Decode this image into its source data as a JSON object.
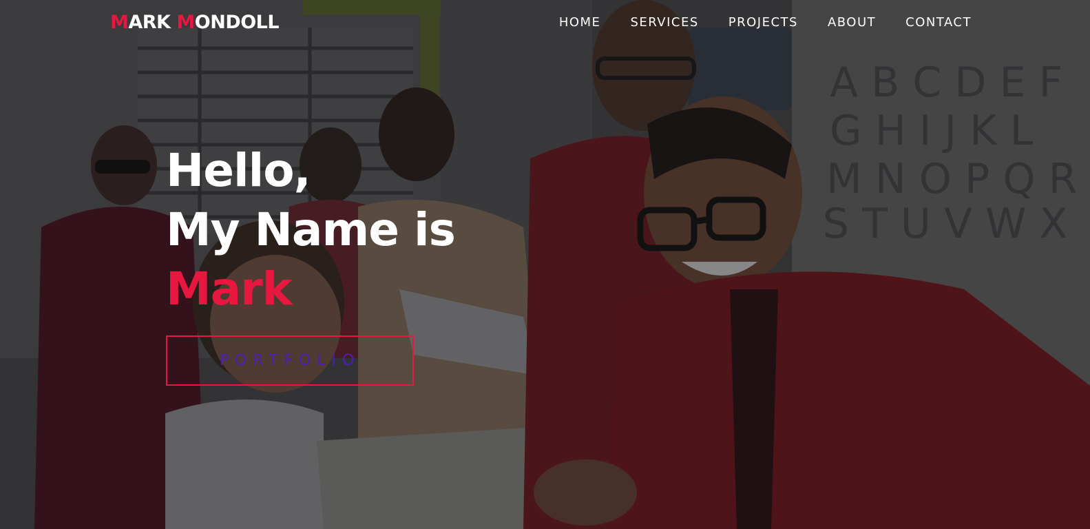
{
  "brand": {
    "first_initial": "M",
    "first_rest": "ARK ",
    "last_initial": "M",
    "last_rest": "ONDOLL"
  },
  "nav": {
    "items": [
      {
        "label": "HOME"
      },
      {
        "label": "SERVICES"
      },
      {
        "label": "PROJECTS"
      },
      {
        "label": "ABOUT"
      },
      {
        "label": "CONTACT"
      }
    ]
  },
  "hero": {
    "line1": "Hello,",
    "line2": "My Name is",
    "name": "Mark",
    "button_label": "PORTFOLIO"
  },
  "colors": {
    "accent": "#e8173f",
    "button_text": "#4b1fb4",
    "text": "#ffffff"
  }
}
